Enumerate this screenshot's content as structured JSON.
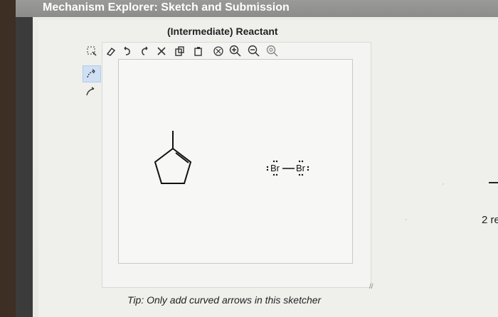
{
  "window": {
    "title": "Mechanism Explorer: Sketch and Submission"
  },
  "panel": {
    "subtitle": "(Intermediate) Reactant",
    "tip": "Tip: Only add curved arrows in this sketcher",
    "right_label": "2 re"
  },
  "toolbar": {
    "tools": [
      {
        "name": "select-tool",
        "glyph": "⬚"
      },
      {
        "name": "erase-tool",
        "glyph": "⌀"
      },
      {
        "name": "undo-tool",
        "glyph": "↶"
      },
      {
        "name": "redo-tool",
        "glyph": "↷"
      },
      {
        "name": "cut-tool",
        "glyph": "✕"
      },
      {
        "name": "copy-tool",
        "glyph": "⧉"
      },
      {
        "name": "paste-tool",
        "glyph": "⧉"
      },
      {
        "name": "clean-tool",
        "glyph": "⊗"
      },
      {
        "name": "zoom-in-tool",
        "glyph": "⊕"
      },
      {
        "name": "zoom-out-tool",
        "glyph": "⊖"
      },
      {
        "name": "zoom-fit-tool",
        "glyph": "◎"
      }
    ]
  },
  "side_tools": [
    {
      "name": "curved-arrow-full-tool",
      "glyph": "⤴",
      "active": true
    },
    {
      "name": "curved-arrow-half-tool",
      "glyph": "⤴",
      "active": false
    }
  ],
  "molecule": {
    "reagent_label": ":Br—Br:",
    "atom_left": "Br",
    "atom_right": "Br"
  }
}
